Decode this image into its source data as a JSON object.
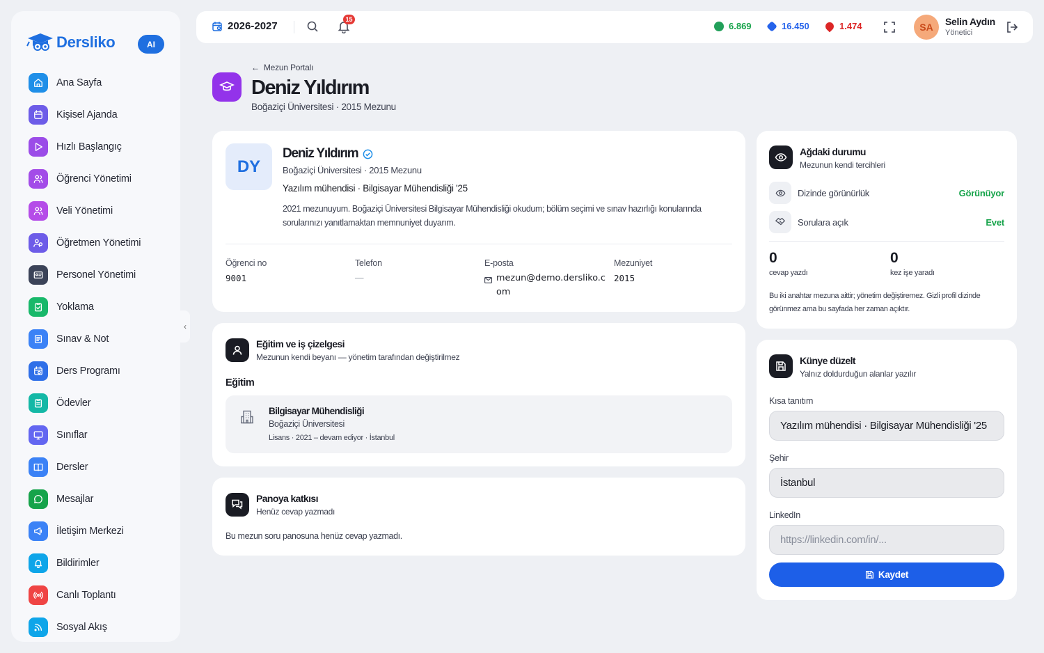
{
  "brand": {
    "name": "Dersliko",
    "ai_label": "AI"
  },
  "sidebar": {
    "items": [
      {
        "label": "Ana Sayfa",
        "icon": "home-icon",
        "color": "#1f8fe8"
      },
      {
        "label": "Kişisel Ajanda",
        "icon": "calendar-icon",
        "color": "#6d5ce8"
      },
      {
        "label": "Hızlı Başlangıç",
        "icon": "play-icon",
        "color": "#9b4ce8"
      },
      {
        "label": "Öğrenci Yönetimi",
        "icon": "users-icon",
        "color": "#a34ce8"
      },
      {
        "label": "Veli Yönetimi",
        "icon": "user-group-icon",
        "color": "#b54ce8"
      },
      {
        "label": "Öğretmen Yönetimi",
        "icon": "teacher-icon",
        "color": "#6d5ce8"
      },
      {
        "label": "Personel Yönetimi",
        "icon": "id-card-icon",
        "color": "#3b4358"
      },
      {
        "label": "Yoklama",
        "icon": "clipboard-check-icon",
        "color": "#18b86a"
      },
      {
        "label": "Sınav & Not",
        "icon": "exam-icon",
        "color": "#3b82f6"
      },
      {
        "label": "Ders Programı",
        "icon": "calendar-clock-icon",
        "color": "#2f6fe8"
      },
      {
        "label": "Ödevler",
        "icon": "clipboard-list-icon",
        "color": "#14b8a6"
      },
      {
        "label": "Sınıflar",
        "icon": "monitor-icon",
        "color": "#6366f1"
      },
      {
        "label": "Dersler",
        "icon": "book-icon",
        "color": "#3b82f6"
      },
      {
        "label": "Mesajlar",
        "icon": "chat-icon",
        "color": "#16a34a"
      },
      {
        "label": "İletişim Merkezi",
        "icon": "megaphone-icon",
        "color": "#3b82f6"
      },
      {
        "label": "Bildirimler",
        "icon": "bell-icon",
        "color": "#0ea5e9"
      },
      {
        "label": "Canlı Toplantı",
        "icon": "broadcast-icon",
        "color": "#ef4444"
      },
      {
        "label": "Sosyal Akış",
        "icon": "rss-icon",
        "color": "#0ea5e9"
      }
    ]
  },
  "topbar": {
    "year": "2026-2027",
    "notif_count": "15",
    "stats": [
      {
        "value": "6.869",
        "color": "#16a34a"
      },
      {
        "value": "16.450",
        "color": "#2563eb"
      },
      {
        "value": "1.474",
        "color": "#dc2626"
      }
    ],
    "user": {
      "initials": "SA",
      "name": "Selin Aydın",
      "role": "Yönetici"
    }
  },
  "header": {
    "breadcrumb": "Mezun Portalı",
    "title": "Deniz Yıldırım",
    "subtitle": "Boğaziçi Üniversitesi · 2015 Mezunu"
  },
  "profile": {
    "initials": "DY",
    "name": "Deniz Yıldırım",
    "school": "Boğaziçi Üniversitesi · 2015 Mezunu",
    "tagline": "Yazılım mühendisi · Bilgisayar Mühendisliği '25",
    "bio": "2021 mezunuyum. Boğaziçi Üniversitesi Bilgisayar Mühendisliği okudum; bölüm seçimi ve sınav hazırlığı konularında sorularınızı yanıtlamaktan memnuniyet duyarım.",
    "fields": {
      "student_no": {
        "label": "Öğrenci no",
        "value": "9001"
      },
      "phone": {
        "label": "Telefon",
        "value": "—"
      },
      "email": {
        "label": "E-posta",
        "value": "mezun@demo.dersliko.com"
      },
      "grad": {
        "label": "Mezuniyet",
        "value": "2015"
      }
    }
  },
  "education": {
    "title": "Eğitim ve iş çizelgesi",
    "subtitle": "Mezunun kendi beyanı — yönetim tarafından değiştirilmez",
    "section": "Eğitim",
    "entry": {
      "title": "Bilgisayar Mühendisliği",
      "school": "Boğaziçi Üniversitesi",
      "meta": "Lisans · 2021 – devam ediyor · İstanbul"
    }
  },
  "board": {
    "title": "Panoya katkısı",
    "subtitle": "Henüz cevap yazmadı",
    "note": "Bu mezun soru panosuna henüz cevap yazmadı."
  },
  "network": {
    "title": "Ağdaki durumu",
    "subtitle": "Mezunun kendi tercihleri",
    "rows": [
      {
        "label": "Dizinde görünürlük",
        "value": "Görünüyor"
      },
      {
        "label": "Sorulara açık",
        "value": "Evet"
      }
    ],
    "answers": {
      "value": "0",
      "label": "cevap yazdı"
    },
    "helped": {
      "value": "0",
      "label": "kez işe yaradı"
    },
    "note": "Bu iki anahtar mezuna aittir; yönetim değiştiremez. Gizli profil dizinde görünmez ama bu sayfada her zaman açıktır."
  },
  "edit": {
    "title": "Künye düzelt",
    "subtitle": "Yalnız doldurduğun alanlar yazılır",
    "fields": [
      {
        "label": "Kısa tanıtım",
        "value": "Yazılım mühendisi · Bilgisayar Mühendisliği '25",
        "placeholder": ""
      },
      {
        "label": "Şehir",
        "value": "İstanbul",
        "placeholder": ""
      },
      {
        "label": "LinkedIn",
        "value": "",
        "placeholder": "https://linkedin.com/in/..."
      }
    ],
    "save_label": "Kaydet"
  }
}
